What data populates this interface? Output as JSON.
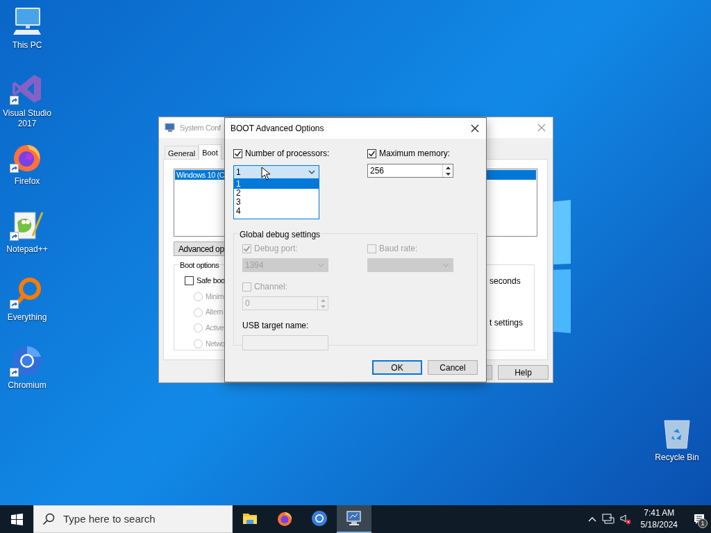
{
  "desktop_icons": [
    {
      "label": "This PC",
      "shortcut": false
    },
    {
      "label": "Visual Studio 2017",
      "shortcut": true
    },
    {
      "label": "Firefox",
      "shortcut": true
    },
    {
      "label": "Notepad++",
      "shortcut": true
    },
    {
      "label": "Everything",
      "shortcut": true
    },
    {
      "label": "Chromium",
      "shortcut": true
    }
  ],
  "recycle_bin": {
    "label": "Recycle Bin"
  },
  "background_window": {
    "title": "System Conf",
    "tabs": [
      {
        "label": "General",
        "selected": false
      },
      {
        "label": "Boot",
        "selected": true
      }
    ],
    "os_list": [
      {
        "label": "Windows 10 (C",
        "selected": true
      }
    ],
    "advanced_button": "Advanced op",
    "boot_options": {
      "title": "Boot options",
      "safe_boot": {
        "label": "Safe boo",
        "checked": false
      },
      "radios": [
        {
          "label": "Minim",
          "checked": false,
          "disabled": true
        },
        {
          "label": "Altern",
          "checked": false,
          "disabled": true
        },
        {
          "label": "Active",
          "checked": false,
          "disabled": true
        },
        {
          "label": "Netwo",
          "checked": false,
          "disabled": true
        }
      ]
    },
    "timeout_unit": "seconds",
    "boot_settings_label": "t settings",
    "help_button": "Help"
  },
  "dialog": {
    "title": "BOOT Advanced Options",
    "processors": {
      "label": "Number of processors:",
      "checked": true,
      "value": "1",
      "expanded": true,
      "options": [
        {
          "label": "1",
          "selected": true
        },
        {
          "label": "2",
          "selected": false
        },
        {
          "label": "3",
          "selected": false
        },
        {
          "label": "4",
          "selected": false
        }
      ]
    },
    "memory": {
      "label": "Maximum memory:",
      "checked": true,
      "value": "256"
    },
    "debug": {
      "title": "Global debug settings",
      "debug_port": {
        "label": "Debug port:",
        "checked": true,
        "disabled": true,
        "value": "1394"
      },
      "baud_rate": {
        "label": "Baud rate:",
        "checked": false,
        "disabled": true
      },
      "channel": {
        "label": "Channel:",
        "checked": false,
        "disabled": true,
        "value": "0"
      },
      "usb_target": {
        "label": "USB target name:",
        "disabled": true
      }
    },
    "buttons": [
      {
        "label": "OK",
        "default": true
      },
      {
        "label": "Cancel",
        "default": false
      }
    ]
  },
  "taskbar": {
    "search": {
      "placeholder": "Type here to search"
    },
    "apps": [
      {
        "selected": false
      },
      {
        "selected": false
      },
      {
        "selected": false
      },
      {
        "selected": true
      }
    ],
    "time": "7:41 AM",
    "date": "5/18/2024",
    "notifications": "1"
  }
}
